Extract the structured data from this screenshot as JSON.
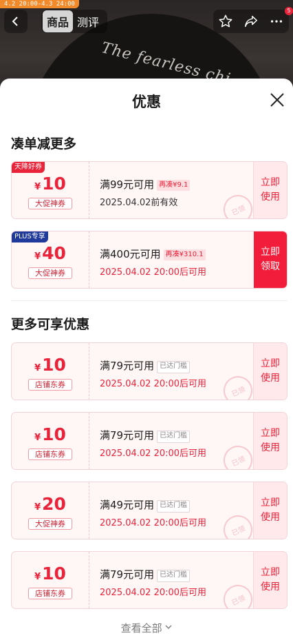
{
  "top_bar": {
    "promo_strip": "4.2 20:00-4.3 24:00",
    "tabs": [
      {
        "label": "商品",
        "active": true
      },
      {
        "label": "测评",
        "active": false
      }
    ],
    "shirt_print": "The fearless chi",
    "notification_count": "5"
  },
  "sheet": {
    "title": "优惠",
    "section1_title": "凑单减更多",
    "section2_title": "更多可享优惠",
    "see_all_label": "查看全部"
  },
  "coupons": [
    {
      "corner": "天降好券",
      "corner_color": "#e8233a",
      "currency": "¥",
      "amount": "10",
      "type": "大促神券",
      "condition": "满99元可用",
      "badge": "再凑¥9.1",
      "date": "2025.04.02前有效",
      "action_line1": "立即",
      "action_line2": "使用",
      "stamp": "已领"
    },
    {
      "corner": "PLUS专享",
      "corner_color": "#1f3a9a",
      "currency": "¥",
      "amount": "40",
      "type": "大促神券",
      "condition": "满400元可用",
      "badge": "再凑¥310.1",
      "date": "2025.04.02 20:00后可用",
      "action_line1": "立即",
      "action_line2": "领取"
    },
    {
      "currency": "¥",
      "amount": "10",
      "type": "店铺东券",
      "condition": "满79元可用",
      "badge": "已达门槛",
      "date": "2025.04.02 20:00后可用",
      "action_line1": "立即",
      "action_line2": "使用",
      "stamp": "已领"
    },
    {
      "currency": "¥",
      "amount": "10",
      "type": "店铺东券",
      "condition": "满79元可用",
      "badge": "已达门槛",
      "date": "2025.04.02 20:00后可用",
      "action_line1": "立即",
      "action_line2": "使用",
      "stamp": "已领"
    },
    {
      "currency": "¥",
      "amount": "20",
      "type": "大促神券",
      "condition": "满49元可用",
      "badge": "已达门槛",
      "date": "2025.04.02 20:00后可用",
      "action_line1": "立即",
      "action_line2": "使用",
      "stamp": "已领"
    },
    {
      "currency": "¥",
      "amount": "10",
      "type": "店铺东券",
      "condition": "满79元可用",
      "badge": "已达门槛",
      "date": "2025.04.02 20:00后可用",
      "action_line1": "立即",
      "action_line2": "使用",
      "stamp": "已领"
    }
  ]
}
